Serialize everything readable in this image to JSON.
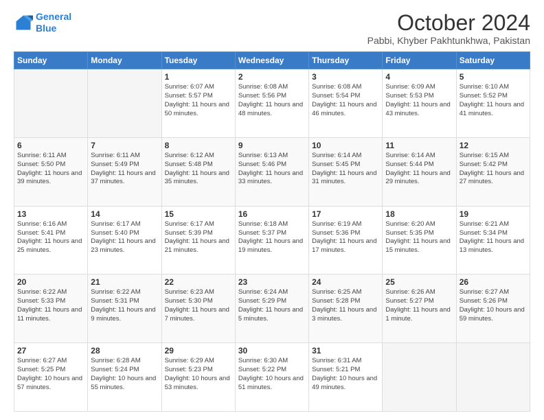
{
  "header": {
    "logo_line1": "General",
    "logo_line2": "Blue",
    "title": "October 2024",
    "subtitle": "Pabbi, Khyber Pakhtunkhwa, Pakistan"
  },
  "days_of_week": [
    "Sunday",
    "Monday",
    "Tuesday",
    "Wednesday",
    "Thursday",
    "Friday",
    "Saturday"
  ],
  "weeks": [
    [
      {
        "num": "",
        "sunrise": "",
        "sunset": "",
        "daylight": "",
        "empty": true
      },
      {
        "num": "",
        "sunrise": "",
        "sunset": "",
        "daylight": "",
        "empty": true
      },
      {
        "num": "1",
        "sunrise": "Sunrise: 6:07 AM",
        "sunset": "Sunset: 5:57 PM",
        "daylight": "Daylight: 11 hours and 50 minutes."
      },
      {
        "num": "2",
        "sunrise": "Sunrise: 6:08 AM",
        "sunset": "Sunset: 5:56 PM",
        "daylight": "Daylight: 11 hours and 48 minutes."
      },
      {
        "num": "3",
        "sunrise": "Sunrise: 6:08 AM",
        "sunset": "Sunset: 5:54 PM",
        "daylight": "Daylight: 11 hours and 46 minutes."
      },
      {
        "num": "4",
        "sunrise": "Sunrise: 6:09 AM",
        "sunset": "Sunset: 5:53 PM",
        "daylight": "Daylight: 11 hours and 43 minutes."
      },
      {
        "num": "5",
        "sunrise": "Sunrise: 6:10 AM",
        "sunset": "Sunset: 5:52 PM",
        "daylight": "Daylight: 11 hours and 41 minutes."
      }
    ],
    [
      {
        "num": "6",
        "sunrise": "Sunrise: 6:11 AM",
        "sunset": "Sunset: 5:50 PM",
        "daylight": "Daylight: 11 hours and 39 minutes."
      },
      {
        "num": "7",
        "sunrise": "Sunrise: 6:11 AM",
        "sunset": "Sunset: 5:49 PM",
        "daylight": "Daylight: 11 hours and 37 minutes."
      },
      {
        "num": "8",
        "sunrise": "Sunrise: 6:12 AM",
        "sunset": "Sunset: 5:48 PM",
        "daylight": "Daylight: 11 hours and 35 minutes."
      },
      {
        "num": "9",
        "sunrise": "Sunrise: 6:13 AM",
        "sunset": "Sunset: 5:46 PM",
        "daylight": "Daylight: 11 hours and 33 minutes."
      },
      {
        "num": "10",
        "sunrise": "Sunrise: 6:14 AM",
        "sunset": "Sunset: 5:45 PM",
        "daylight": "Daylight: 11 hours and 31 minutes."
      },
      {
        "num": "11",
        "sunrise": "Sunrise: 6:14 AM",
        "sunset": "Sunset: 5:44 PM",
        "daylight": "Daylight: 11 hours and 29 minutes."
      },
      {
        "num": "12",
        "sunrise": "Sunrise: 6:15 AM",
        "sunset": "Sunset: 5:42 PM",
        "daylight": "Daylight: 11 hours and 27 minutes."
      }
    ],
    [
      {
        "num": "13",
        "sunrise": "Sunrise: 6:16 AM",
        "sunset": "Sunset: 5:41 PM",
        "daylight": "Daylight: 11 hours and 25 minutes."
      },
      {
        "num": "14",
        "sunrise": "Sunrise: 6:17 AM",
        "sunset": "Sunset: 5:40 PM",
        "daylight": "Daylight: 11 hours and 23 minutes."
      },
      {
        "num": "15",
        "sunrise": "Sunrise: 6:17 AM",
        "sunset": "Sunset: 5:39 PM",
        "daylight": "Daylight: 11 hours and 21 minutes."
      },
      {
        "num": "16",
        "sunrise": "Sunrise: 6:18 AM",
        "sunset": "Sunset: 5:37 PM",
        "daylight": "Daylight: 11 hours and 19 minutes."
      },
      {
        "num": "17",
        "sunrise": "Sunrise: 6:19 AM",
        "sunset": "Sunset: 5:36 PM",
        "daylight": "Daylight: 11 hours and 17 minutes."
      },
      {
        "num": "18",
        "sunrise": "Sunrise: 6:20 AM",
        "sunset": "Sunset: 5:35 PM",
        "daylight": "Daylight: 11 hours and 15 minutes."
      },
      {
        "num": "19",
        "sunrise": "Sunrise: 6:21 AM",
        "sunset": "Sunset: 5:34 PM",
        "daylight": "Daylight: 11 hours and 13 minutes."
      }
    ],
    [
      {
        "num": "20",
        "sunrise": "Sunrise: 6:22 AM",
        "sunset": "Sunset: 5:33 PM",
        "daylight": "Daylight: 11 hours and 11 minutes."
      },
      {
        "num": "21",
        "sunrise": "Sunrise: 6:22 AM",
        "sunset": "Sunset: 5:31 PM",
        "daylight": "Daylight: 11 hours and 9 minutes."
      },
      {
        "num": "22",
        "sunrise": "Sunrise: 6:23 AM",
        "sunset": "Sunset: 5:30 PM",
        "daylight": "Daylight: 11 hours and 7 minutes."
      },
      {
        "num": "23",
        "sunrise": "Sunrise: 6:24 AM",
        "sunset": "Sunset: 5:29 PM",
        "daylight": "Daylight: 11 hours and 5 minutes."
      },
      {
        "num": "24",
        "sunrise": "Sunrise: 6:25 AM",
        "sunset": "Sunset: 5:28 PM",
        "daylight": "Daylight: 11 hours and 3 minutes."
      },
      {
        "num": "25",
        "sunrise": "Sunrise: 6:26 AM",
        "sunset": "Sunset: 5:27 PM",
        "daylight": "Daylight: 11 hours and 1 minute."
      },
      {
        "num": "26",
        "sunrise": "Sunrise: 6:27 AM",
        "sunset": "Sunset: 5:26 PM",
        "daylight": "Daylight: 10 hours and 59 minutes."
      }
    ],
    [
      {
        "num": "27",
        "sunrise": "Sunrise: 6:27 AM",
        "sunset": "Sunset: 5:25 PM",
        "daylight": "Daylight: 10 hours and 57 minutes."
      },
      {
        "num": "28",
        "sunrise": "Sunrise: 6:28 AM",
        "sunset": "Sunset: 5:24 PM",
        "daylight": "Daylight: 10 hours and 55 minutes."
      },
      {
        "num": "29",
        "sunrise": "Sunrise: 6:29 AM",
        "sunset": "Sunset: 5:23 PM",
        "daylight": "Daylight: 10 hours and 53 minutes."
      },
      {
        "num": "30",
        "sunrise": "Sunrise: 6:30 AM",
        "sunset": "Sunset: 5:22 PM",
        "daylight": "Daylight: 10 hours and 51 minutes."
      },
      {
        "num": "31",
        "sunrise": "Sunrise: 6:31 AM",
        "sunset": "Sunset: 5:21 PM",
        "daylight": "Daylight: 10 hours and 49 minutes."
      },
      {
        "num": "",
        "sunrise": "",
        "sunset": "",
        "daylight": "",
        "empty": true
      },
      {
        "num": "",
        "sunrise": "",
        "sunset": "",
        "daylight": "",
        "empty": true
      }
    ]
  ]
}
